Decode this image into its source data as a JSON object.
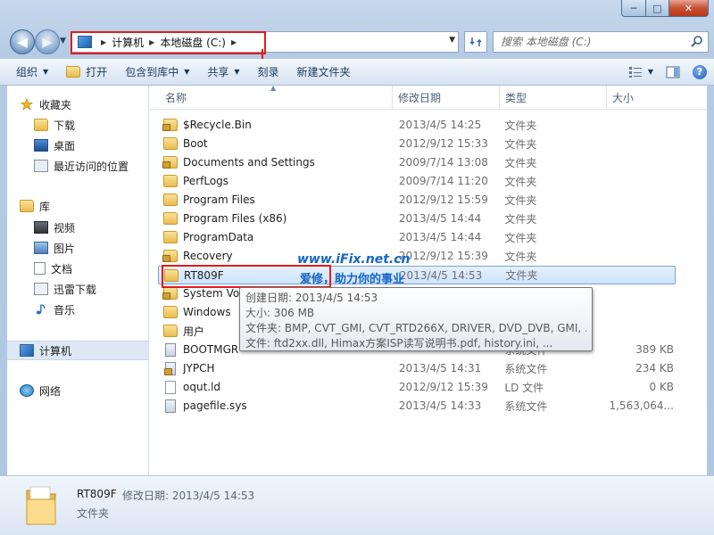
{
  "window": {
    "caption": {
      "minimize": "─",
      "maximize": "□",
      "close": "✕"
    }
  },
  "nav": {
    "back": "◀",
    "forward": "▶"
  },
  "address": {
    "segments": [
      "计算机",
      "本地磁盘 (C:)"
    ]
  },
  "search": {
    "placeholder": "搜索 本地磁盘 (C:)"
  },
  "toolbar": {
    "organize": "组织",
    "open": "打开",
    "include_in_library": "包含到库中",
    "share": "共享",
    "burn": "刻录",
    "new_folder": "新建文件夹"
  },
  "sidebar": {
    "favorites": "收藏夹",
    "downloads": "下载",
    "desktop": "桌面",
    "recent": "最近访问的位置",
    "libraries": "库",
    "videos": "视频",
    "pictures": "图片",
    "documents": "文档",
    "thunder": "迅雷下载",
    "music": "音乐",
    "computer": "计算机",
    "network": "网络"
  },
  "columns": {
    "name": "名称",
    "date": "修改日期",
    "type": "类型",
    "size": "大小"
  },
  "files": [
    {
      "name": "$Recycle.Bin",
      "date": "2013/4/5 14:25",
      "type": "文件夹",
      "size": "",
      "icon": "folder-lock"
    },
    {
      "name": "Boot",
      "date": "2012/9/12 15:33",
      "type": "文件夹",
      "size": "",
      "icon": "folder"
    },
    {
      "name": "Documents and Settings",
      "date": "2009/7/14 13:08",
      "type": "文件夹",
      "size": "",
      "icon": "folder-lock"
    },
    {
      "name": "PerfLogs",
      "date": "2009/7/14 11:20",
      "type": "文件夹",
      "size": "",
      "icon": "folder"
    },
    {
      "name": "Program Files",
      "date": "2012/9/12 15:59",
      "type": "文件夹",
      "size": "",
      "icon": "folder"
    },
    {
      "name": "Program Files (x86)",
      "date": "2013/4/5 14:44",
      "type": "文件夹",
      "size": "",
      "icon": "folder"
    },
    {
      "name": "ProgramData",
      "date": "2013/4/5 14:44",
      "type": "文件夹",
      "size": "",
      "icon": "folder"
    },
    {
      "name": "Recovery",
      "date": "2012/9/12 15:39",
      "type": "文件夹",
      "size": "",
      "icon": "folder-lock"
    },
    {
      "name": "RT809F",
      "date": "2013/4/5 14:53",
      "type": "文件夹",
      "size": "",
      "icon": "folder"
    },
    {
      "name": "System Vol",
      "date": "",
      "type": "文件夹",
      "size": "",
      "icon": "folder-lock"
    },
    {
      "name": "Windows",
      "date": "",
      "type": "文件夹",
      "size": "",
      "icon": "folder"
    },
    {
      "name": "用户",
      "date": "",
      "type": "文件夹",
      "size": "",
      "icon": "folder"
    },
    {
      "name": "BOOTMGR",
      "date": "",
      "type": "系统文件",
      "size": "389 KB",
      "icon": "sys-file"
    },
    {
      "name": "JYPCH",
      "date": "2013/4/5 14:31",
      "type": "系统文件",
      "size": "234 KB",
      "icon": "sys-file-lock"
    },
    {
      "name": "oqut.ld",
      "date": "2012/9/12 15:39",
      "type": "LD 文件",
      "size": "0 KB",
      "icon": "file"
    },
    {
      "name": "pagefile.sys",
      "date": "2013/4/5 14:33",
      "type": "系统文件",
      "size": "1,563,064...",
      "icon": "sys-file"
    }
  ],
  "selected_index": 8,
  "watermark": {
    "line1": "www.iFix.net.cn",
    "line2": "爱修，助力你的事业"
  },
  "tooltip": {
    "created": "创建日期: 2013/4/5 14:53",
    "size": "大小: 306 MB",
    "folders": "文件夹: BMP, CVT_GMI, CVT_RTD266X, DRIVER, DVD_DVB, GMI, ...",
    "files": "文件: ftd2xx.dll, Himax方案ISP读写说明书.pdf, history.ini, ..."
  },
  "details": {
    "name": "RT809F",
    "date_label": "修改日期: 2013/4/5 14:53",
    "type": "文件夹"
  },
  "colors": {
    "accent": "#1e395b",
    "selection": "#cde3fb",
    "annotation_red": "#e31b1b",
    "watermark_blue": "#1565c5"
  }
}
